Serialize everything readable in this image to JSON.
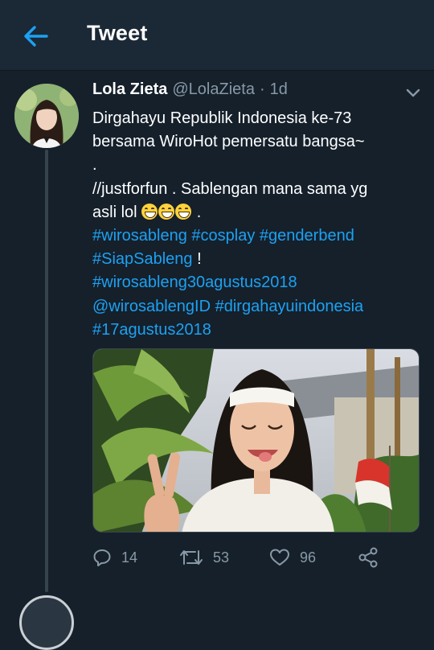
{
  "header": {
    "title": "Tweet",
    "back_icon": "arrow-left-icon",
    "accent": "#1da1f2"
  },
  "tweet": {
    "display_name": "Lola Zieta",
    "handle": "@LolaZieta",
    "separator": "·",
    "time": "1d",
    "body": {
      "line1": "Dirgahayu Republik Indonesia ke-73",
      "line2": "bersama WiroHot pemersatu bangsa~",
      "line3": ".",
      "line4": "//justforfun . Sablengan mana sama yg",
      "line5_text": "asli lol",
      "line5_suffix": " .",
      "emoji_count": 3,
      "emoji_name": "grinning-squinting-face",
      "hashtag1": "#wirosableng",
      "hashtag2": "#cosplay",
      "hashtag3": "#genderbend",
      "hashtag4": "#SiapSableng",
      "line7_suffix": " !",
      "hashtag5": "#wirosableng30agustus2018",
      "mention1": "@wirosablengID",
      "hashtag6": "#dirgahayuindonesia",
      "hashtag7": "#17agustus2018"
    },
    "actions": {
      "replies": "14",
      "retweets": "53",
      "likes": "96"
    }
  },
  "colors": {
    "background": "#15202b",
    "header_bg": "#1b2836",
    "muted": "#8899a6",
    "link": "#1da1f2"
  }
}
